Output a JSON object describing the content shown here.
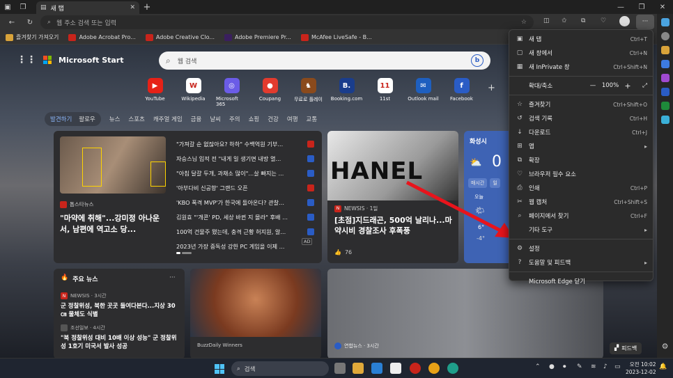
{
  "browser": {
    "tab_title": "새 탭",
    "address_placeholder": "웹 주소 검색 또는 입력"
  },
  "bookmarks": [
    {
      "label": "즐겨찾기 가져오기",
      "color": "#d9a33a"
    },
    {
      "label": "Adobe Acrobat Pro...",
      "color": "#c8241b"
    },
    {
      "label": "Adobe Creative Clo...",
      "color": "#c8241b"
    },
    {
      "label": "Adobe Premiere Pr...",
      "color": "#3a1f5e"
    },
    {
      "label": "McAfee LiveSafe - B...",
      "color": "#c8241b"
    }
  ],
  "start": {
    "logo": "Microsoft Start",
    "search_placeholder": "웹 검색",
    "quicklinks": [
      {
        "label": "YouTube",
        "glyph": "▶",
        "color": "#e62117"
      },
      {
        "label": "Wikipedia",
        "glyph": "W",
        "color": "#ffffff"
      },
      {
        "label": "Microsoft 365",
        "glyph": "◎",
        "color": "#6b5ce7"
      },
      {
        "label": "Coupang",
        "glyph": "●",
        "color": "#e23b2e"
      },
      {
        "label": "무료로 플레이",
        "glyph": "♞",
        "color": "#8a4a1c"
      },
      {
        "label": "Booking.com",
        "glyph": "B.",
        "color": "#1a3d8c"
      },
      {
        "label": "11st",
        "glyph": "11",
        "color": "#ffffff"
      },
      {
        "label": "Outlook mail",
        "glyph": "✉",
        "color": "#1e5fbf"
      },
      {
        "label": "Facebook",
        "glyph": "f",
        "color": "#2a5cc5"
      }
    ],
    "tabs": [
      "발견하기",
      "팔로우"
    ],
    "categories": [
      "뉴스",
      "스포츠",
      "캐주얼 게임",
      "금융",
      "날씨",
      "주의",
      "쇼핑",
      "건강",
      "여행",
      "교통"
    ],
    "headline_card": {
      "source": "톱스타뉴스",
      "title": "\"마약에 취해\"...강미정 아나운서, 남편에 역고소 당..."
    },
    "news_list": [
      {
        "title": "\"가져갈 순 없잖아요? 하하\" 수백억원 기부...",
        "color": "#c8241b"
      },
      {
        "title": "자승스님 입적 전 \"내게 일 생기면 내방 열...",
        "color": "#2a5cc5"
      },
      {
        "title": "\"아침 달걀 두개, 과채소 많이\"...살 빠지는 ...",
        "color": "#2a5cc5"
      },
      {
        "title": "'아부다비 신공항' 그랜드 오픈",
        "color": "#c8241b"
      },
      {
        "title": "'KBO 폭격 MVP'가 한국에 돌아온다? 관찰...",
        "color": "#2a5cc5"
      },
      {
        "title": "김원효 \"'개콘' PD, 세상 바뀐 지 몰라\" 후배 ...",
        "color": "#2a5cc5"
      },
      {
        "title": "100억 건물주 됐는데, 충격 근황 허지원, 알...",
        "color": "#2a5cc5"
      },
      {
        "title": "2023년 가장 중독성 강한 PC 게임을 이제 ...",
        "color": "#555"
      }
    ],
    "ad_label": "AD",
    "feature_card": {
      "source": "NEWSIS · 1일",
      "title": "[초점]지드래곤, 500억 날리나...마약시비 경찰조사 후폭풍",
      "likes": "76",
      "image_text": "HANEL"
    },
    "weather": {
      "city": "화성시",
      "temp": "0",
      "tabs": [
        "매시간",
        "일"
      ],
      "day": "오늘",
      "hi": "6°",
      "lo": "-4°"
    },
    "top_news": {
      "heading": "주요 뉴스",
      "items": [
        {
          "source": "NEWSIS · 3시간",
          "title": "군 정찰위성, 북한 곳곳 들여다본다...지상 30㎝ 물체도 식별"
        },
        {
          "source": "조선일보 · 4시간",
          "title": "\"북 정찰위성 대비 10배 이상 성능\" 군 정찰위성 1호기 미국서 발사 성공"
        }
      ]
    },
    "buzz_source": "BuzzDaily Winners",
    "yonhap_source": "연합뉴스 · 3시간",
    "feedback_label": "피드백"
  },
  "menu": {
    "zoom_label": "확대/축소",
    "zoom_value": "100%",
    "items": [
      {
        "label": "새 탭",
        "shortcut": "Ctrl+T",
        "icon": "▣"
      },
      {
        "label": "새 창에서",
        "shortcut": "Ctrl+N",
        "icon": "▢"
      },
      {
        "label": "새 InPrivate 창",
        "shortcut": "Ctrl+Shift+N",
        "icon": "▦"
      }
    ],
    "items2": [
      {
        "label": "즐겨찾기",
        "shortcut": "Ctrl+Shift+O",
        "icon": "☆"
      },
      {
        "label": "검색 기록",
        "shortcut": "Ctrl+H",
        "icon": "↺"
      },
      {
        "label": "다운로드",
        "shortcut": "Ctrl+J",
        "icon": "↓"
      },
      {
        "label": "앱",
        "shortcut": "",
        "icon": "⊞",
        "arrow": "▸"
      },
      {
        "label": "확장",
        "shortcut": "",
        "icon": "⧉"
      },
      {
        "label": "브라우저 필수 요소",
        "shortcut": "",
        "icon": "♡"
      },
      {
        "label": "인쇄",
        "shortcut": "Ctrl+P",
        "icon": "⎙"
      },
      {
        "label": "웹 캡처",
        "shortcut": "Ctrl+Shift+S",
        "icon": "✂"
      },
      {
        "label": "페이지에서 찾기",
        "shortcut": "Ctrl+F",
        "icon": "⌕"
      },
      {
        "label": "기타 도구",
        "shortcut": "",
        "icon": "",
        "arrow": "▸"
      }
    ],
    "items3": [
      {
        "label": "설정",
        "shortcut": "",
        "icon": "⚙"
      },
      {
        "label": "도움말 및 피드백",
        "shortcut": "",
        "icon": "?",
        "arrow": "▸"
      }
    ],
    "close_label": "Microsoft Edge 닫기"
  },
  "taskbar": {
    "search_label": "검색",
    "time": "오전 10:02",
    "date": "2023-12-02"
  }
}
